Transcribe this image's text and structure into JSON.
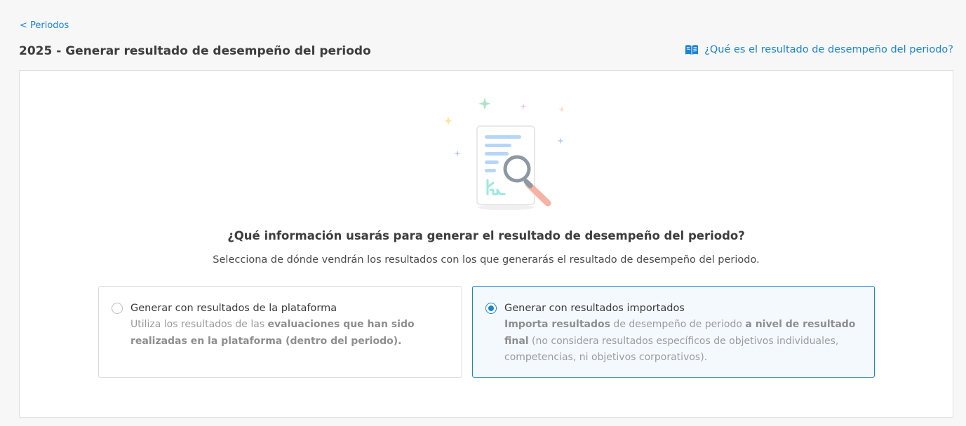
{
  "nav": {
    "back_label": "< Periodos"
  },
  "header": {
    "title": "2025 - Generar resultado de desempeño del periodo",
    "help_label": "¿Qué es el resultado de desempeño del periodo?",
    "help_icon": "book-open-icon"
  },
  "main": {
    "illustration": "document-search-illustration",
    "question": "¿Qué información usarás para generar el resultado de desempeño del periodo?",
    "subtitle": "Selecciona de dónde vendrán los resultados con los que generarás el resultado de desempeño del periodo.",
    "options": [
      {
        "title": "Generar con resultados de la plataforma",
        "desc_p1": "Utiliza los resultados de las ",
        "desc_b1": "evaluaciones que han sido realizadas en la plataforma (dentro del periodo)",
        "desc_p2": ".",
        "selected": false
      },
      {
        "title": "Generar con resultados importados",
        "desc_b1": "Importa resultados",
        "desc_p1": " de desempeño de periodo ",
        "desc_b2": "a nivel de resultado final",
        "desc_p2": " (no considera resultados específicos de objetivos individuales, competencias, ni objetivos corporativos).",
        "selected": true
      }
    ]
  },
  "colors": {
    "accent": "#1b84d6",
    "selected_bg": "#f4f9fe",
    "border": "#dedede"
  }
}
